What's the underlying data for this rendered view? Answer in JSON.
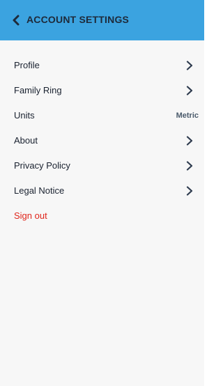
{
  "header": {
    "title": "ACCOUNT SETTINGS",
    "back_icon": "chevron-left-icon",
    "background_color": "#3ba3e0"
  },
  "menu": {
    "items": [
      {
        "label": "Profile",
        "accessory": "chevron-right-icon"
      },
      {
        "label": "Family Ring",
        "accessory": "chevron-right-icon"
      },
      {
        "label": "Units",
        "value": "Metric"
      },
      {
        "label": "About",
        "accessory": "chevron-right-icon"
      },
      {
        "label": "Privacy Policy",
        "accessory": "chevron-right-icon"
      },
      {
        "label": "Legal Notice",
        "accessory": "chevron-right-icon"
      }
    ],
    "sign_out": {
      "label": "Sign out",
      "color": "#e0251b"
    }
  }
}
